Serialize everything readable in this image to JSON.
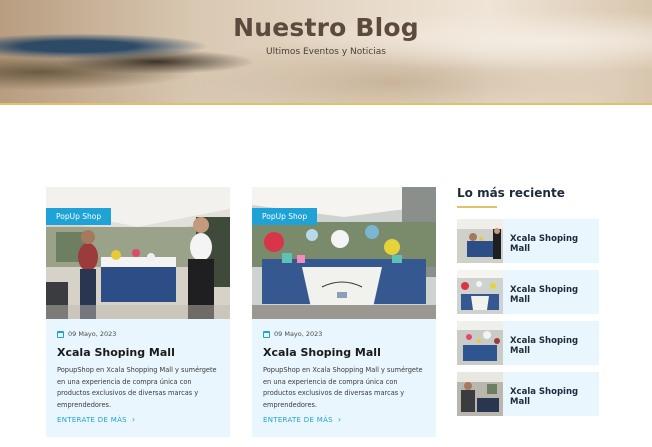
{
  "hero": {
    "title": "Nuestro Blog",
    "subtitle": "Ultimos Eventos y Noticias"
  },
  "posts": [
    {
      "badge": "PopUp Shop",
      "date": "09 Mayo, 2023",
      "title": "Xcala Shoping Mall",
      "excerpt": "PopupShop en Xcala Shopping Mall y sumérgete en una experiencia de compra única con productos exclusivos de diversas marcas y emprendedores.",
      "link": "ENTERATE DE MÁS"
    },
    {
      "badge": "PopUp Shop",
      "date": "09 Mayo, 2023",
      "title": "Xcala Shoping Mall",
      "excerpt": "PopupShop en Xcala Shopping Mall y sumérgete en una experiencia de compra única con productos exclusivos de diversas marcas y emprendedores.",
      "link": "ENTERATE DE MÁS"
    }
  ],
  "sidebar": {
    "title": "Lo más reciente",
    "items": [
      {
        "title": "Xcala Shoping Mall"
      },
      {
        "title": "Xcala Shoping Mall"
      },
      {
        "title": "Xcala Shoping Mall"
      },
      {
        "title": "Xcala Shoping Mall"
      }
    ]
  },
  "colors": {
    "accent": "#1fa2d6",
    "gold": "#e3c06a",
    "card_bg": "#eaf6fd",
    "title_dark": "#1c2b3a"
  },
  "icons": {
    "date": "calendar-icon",
    "link": "chevron-right-icon"
  }
}
